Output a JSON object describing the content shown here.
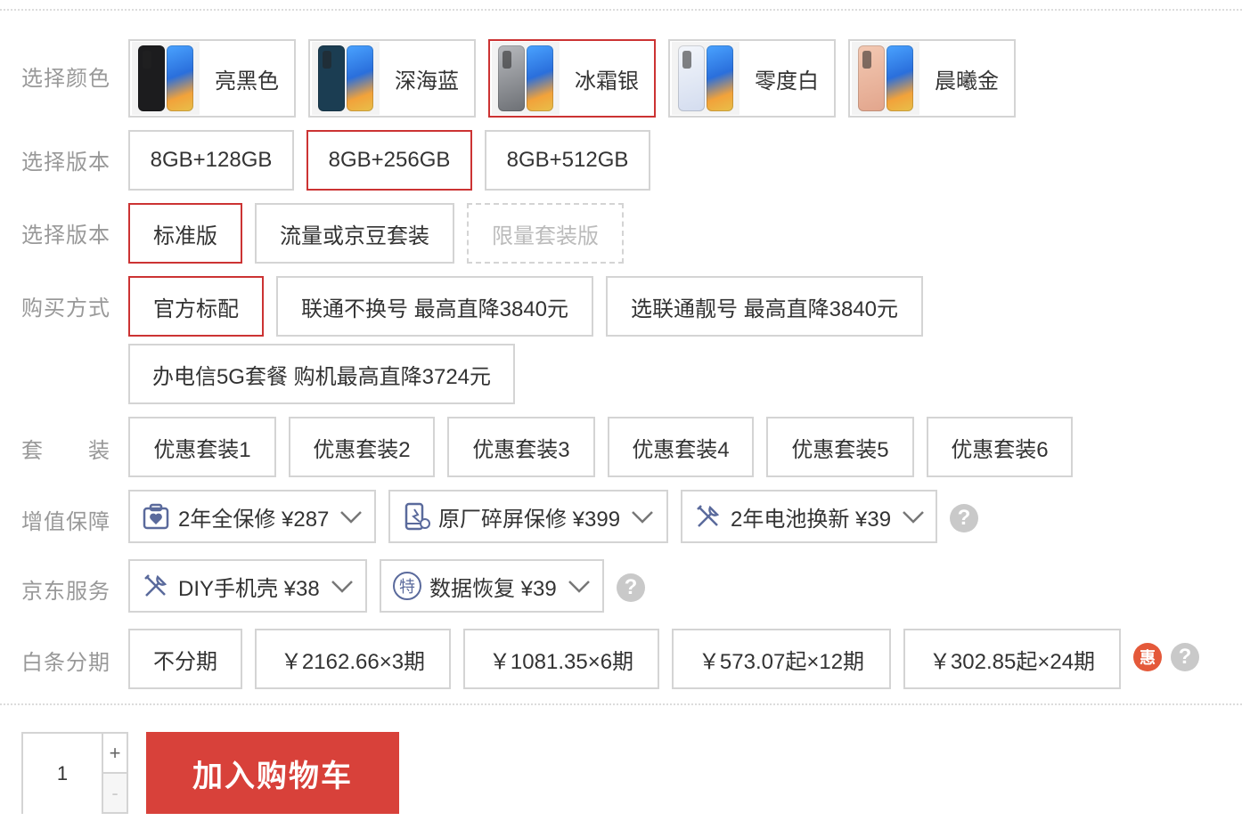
{
  "colors": {
    "label": "选择颜色",
    "options": [
      {
        "label": "亮黑色",
        "back": "#1c1c1e"
      },
      {
        "label": "深海蓝",
        "back": "#1b3d52"
      },
      {
        "label": "冰霜银",
        "back": "#8a8d92"
      },
      {
        "label": "零度白",
        "back": "#dfe6f3"
      },
      {
        "label": "晨曦金",
        "back": "#e9b7a0"
      }
    ],
    "selected_index": 2
  },
  "storage": {
    "label": "选择版本",
    "options": [
      "8GB+128GB",
      "8GB+256GB",
      "8GB+512GB"
    ],
    "selected_index": 1
  },
  "edition": {
    "label": "选择版本",
    "options": [
      "标准版",
      "流量或京豆套装",
      "限量套装版"
    ],
    "selected_index": 0,
    "disabled_index": 2
  },
  "purchase": {
    "label": "购买方式",
    "options": [
      "官方标配",
      "联通不换号  最高直降3840元",
      "选联通靓号  最高直降3840元",
      "办电信5G套餐 购机最高直降3724元"
    ],
    "selected_index": 0
  },
  "bundle": {
    "label": "套　　装",
    "options": [
      "优惠套装1",
      "优惠套装2",
      "优惠套装3",
      "优惠套装4",
      "优惠套装5",
      "优惠套装6"
    ]
  },
  "warranty": {
    "label": "增值保障",
    "items": [
      {
        "label": "2年全保修 ¥287",
        "icon": "shield-heart-icon"
      },
      {
        "label": "原厂碎屏保修 ¥399",
        "icon": "phone-screen-icon"
      },
      {
        "label": "2年电池换新 ¥39",
        "icon": "tools-icon"
      }
    ],
    "help": "?"
  },
  "jd_service": {
    "label": "京东服务",
    "items": [
      {
        "label": "DIY手机壳 ¥38",
        "icon": "tools-icon"
      },
      {
        "label": "数据恢复 ¥39",
        "icon": "special-badge-icon",
        "icon_text": "特"
      }
    ],
    "help": "?"
  },
  "installment": {
    "label": "白条分期",
    "options": [
      "不分期",
      "￥2162.66×3期",
      "￥1081.35×6期",
      "￥573.07起×12期",
      "￥302.85起×24期"
    ],
    "promo_badge": "惠",
    "help": "?"
  },
  "cart": {
    "quantity": "1",
    "plus": "+",
    "minus": "-",
    "add_to_cart": "加入购物车"
  },
  "theme": {
    "accent": "#cc3333",
    "cart_bg": "#d8413a",
    "border": "#d4d4d4"
  }
}
